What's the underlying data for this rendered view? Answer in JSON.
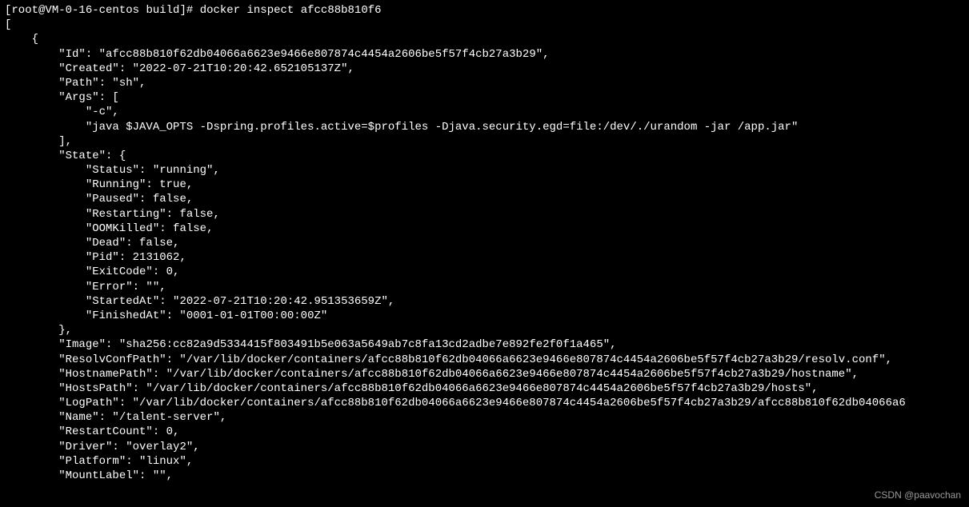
{
  "prompt": {
    "user": "root",
    "host": "VM-0-16-centos",
    "cwd": "build",
    "symbol": "#",
    "command": "docker inspect afcc88b810f6"
  },
  "inspect": {
    "id": "afcc88b810f62db04066a6623e9466e807874c4454a2606be5f57f4cb27a3b29",
    "created": "2022-07-21T10:20:42.652105137Z",
    "path": "sh",
    "args": [
      "-c",
      "java $JAVA_OPTS -Dspring.profiles.active=$profiles -Djava.security.egd=file:/dev/./urandom -jar /app.jar"
    ],
    "state": {
      "status": "running",
      "running": "true",
      "paused": "false",
      "restarting": "false",
      "oomkilled": "false",
      "dead": "false",
      "pid": "2131062",
      "exitcode": "0",
      "error": "",
      "started_at": "2022-07-21T10:20:42.951353659Z",
      "finished_at": "0001-01-01T00:00:00Z"
    },
    "image": "sha256:cc82a9d5334415f803491b5e063a5649ab7c8fa13cd2adbe7e892fe2f0f1a465",
    "resolv_conf_path": "/var/lib/docker/containers/afcc88b810f62db04066a6623e9466e807874c4454a2606be5f57f4cb27a3b29/resolv.conf",
    "hostname_path": "/var/lib/docker/containers/afcc88b810f62db04066a6623e9466e807874c4454a2606be5f57f4cb27a3b29/hostname",
    "hosts_path": "/var/lib/docker/containers/afcc88b810f62db04066a6623e9466e807874c4454a2606be5f57f4cb27a3b29/hosts",
    "log_path": "/var/lib/docker/containers/afcc88b810f62db04066a6623e9466e807874c4454a2606be5f57f4cb27a3b29/afcc88b810f62db04066a6",
    "name": "/talent-server",
    "restart_count": "0",
    "driver": "overlay2",
    "platform": "linux",
    "mount_label": ""
  },
  "watermark": "CSDN @paavochan"
}
